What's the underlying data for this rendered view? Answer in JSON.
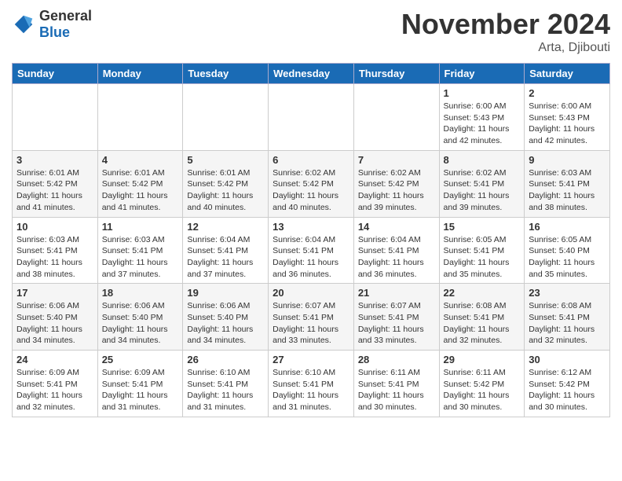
{
  "logo": {
    "general": "General",
    "blue": "Blue"
  },
  "title": "November 2024",
  "subtitle": "Arta, Djibouti",
  "days_header": [
    "Sunday",
    "Monday",
    "Tuesday",
    "Wednesday",
    "Thursday",
    "Friday",
    "Saturday"
  ],
  "weeks": [
    [
      {
        "day": "",
        "info": ""
      },
      {
        "day": "",
        "info": ""
      },
      {
        "day": "",
        "info": ""
      },
      {
        "day": "",
        "info": ""
      },
      {
        "day": "",
        "info": ""
      },
      {
        "day": "1",
        "info": "Sunrise: 6:00 AM\nSunset: 5:43 PM\nDaylight: 11 hours and 42 minutes."
      },
      {
        "day": "2",
        "info": "Sunrise: 6:00 AM\nSunset: 5:43 PM\nDaylight: 11 hours and 42 minutes."
      }
    ],
    [
      {
        "day": "3",
        "info": "Sunrise: 6:01 AM\nSunset: 5:42 PM\nDaylight: 11 hours and 41 minutes."
      },
      {
        "day": "4",
        "info": "Sunrise: 6:01 AM\nSunset: 5:42 PM\nDaylight: 11 hours and 41 minutes."
      },
      {
        "day": "5",
        "info": "Sunrise: 6:01 AM\nSunset: 5:42 PM\nDaylight: 11 hours and 40 minutes."
      },
      {
        "day": "6",
        "info": "Sunrise: 6:02 AM\nSunset: 5:42 PM\nDaylight: 11 hours and 40 minutes."
      },
      {
        "day": "7",
        "info": "Sunrise: 6:02 AM\nSunset: 5:42 PM\nDaylight: 11 hours and 39 minutes."
      },
      {
        "day": "8",
        "info": "Sunrise: 6:02 AM\nSunset: 5:41 PM\nDaylight: 11 hours and 39 minutes."
      },
      {
        "day": "9",
        "info": "Sunrise: 6:03 AM\nSunset: 5:41 PM\nDaylight: 11 hours and 38 minutes."
      }
    ],
    [
      {
        "day": "10",
        "info": "Sunrise: 6:03 AM\nSunset: 5:41 PM\nDaylight: 11 hours and 38 minutes."
      },
      {
        "day": "11",
        "info": "Sunrise: 6:03 AM\nSunset: 5:41 PM\nDaylight: 11 hours and 37 minutes."
      },
      {
        "day": "12",
        "info": "Sunrise: 6:04 AM\nSunset: 5:41 PM\nDaylight: 11 hours and 37 minutes."
      },
      {
        "day": "13",
        "info": "Sunrise: 6:04 AM\nSunset: 5:41 PM\nDaylight: 11 hours and 36 minutes."
      },
      {
        "day": "14",
        "info": "Sunrise: 6:04 AM\nSunset: 5:41 PM\nDaylight: 11 hours and 36 minutes."
      },
      {
        "day": "15",
        "info": "Sunrise: 6:05 AM\nSunset: 5:41 PM\nDaylight: 11 hours and 35 minutes."
      },
      {
        "day": "16",
        "info": "Sunrise: 6:05 AM\nSunset: 5:40 PM\nDaylight: 11 hours and 35 minutes."
      }
    ],
    [
      {
        "day": "17",
        "info": "Sunrise: 6:06 AM\nSunset: 5:40 PM\nDaylight: 11 hours and 34 minutes."
      },
      {
        "day": "18",
        "info": "Sunrise: 6:06 AM\nSunset: 5:40 PM\nDaylight: 11 hours and 34 minutes."
      },
      {
        "day": "19",
        "info": "Sunrise: 6:06 AM\nSunset: 5:40 PM\nDaylight: 11 hours and 34 minutes."
      },
      {
        "day": "20",
        "info": "Sunrise: 6:07 AM\nSunset: 5:41 PM\nDaylight: 11 hours and 33 minutes."
      },
      {
        "day": "21",
        "info": "Sunrise: 6:07 AM\nSunset: 5:41 PM\nDaylight: 11 hours and 33 minutes."
      },
      {
        "day": "22",
        "info": "Sunrise: 6:08 AM\nSunset: 5:41 PM\nDaylight: 11 hours and 32 minutes."
      },
      {
        "day": "23",
        "info": "Sunrise: 6:08 AM\nSunset: 5:41 PM\nDaylight: 11 hours and 32 minutes."
      }
    ],
    [
      {
        "day": "24",
        "info": "Sunrise: 6:09 AM\nSunset: 5:41 PM\nDaylight: 11 hours and 32 minutes."
      },
      {
        "day": "25",
        "info": "Sunrise: 6:09 AM\nSunset: 5:41 PM\nDaylight: 11 hours and 31 minutes."
      },
      {
        "day": "26",
        "info": "Sunrise: 6:10 AM\nSunset: 5:41 PM\nDaylight: 11 hours and 31 minutes."
      },
      {
        "day": "27",
        "info": "Sunrise: 6:10 AM\nSunset: 5:41 PM\nDaylight: 11 hours and 31 minutes."
      },
      {
        "day": "28",
        "info": "Sunrise: 6:11 AM\nSunset: 5:41 PM\nDaylight: 11 hours and 30 minutes."
      },
      {
        "day": "29",
        "info": "Sunrise: 6:11 AM\nSunset: 5:42 PM\nDaylight: 11 hours and 30 minutes."
      },
      {
        "day": "30",
        "info": "Sunrise: 6:12 AM\nSunset: 5:42 PM\nDaylight: 11 hours and 30 minutes."
      }
    ]
  ]
}
